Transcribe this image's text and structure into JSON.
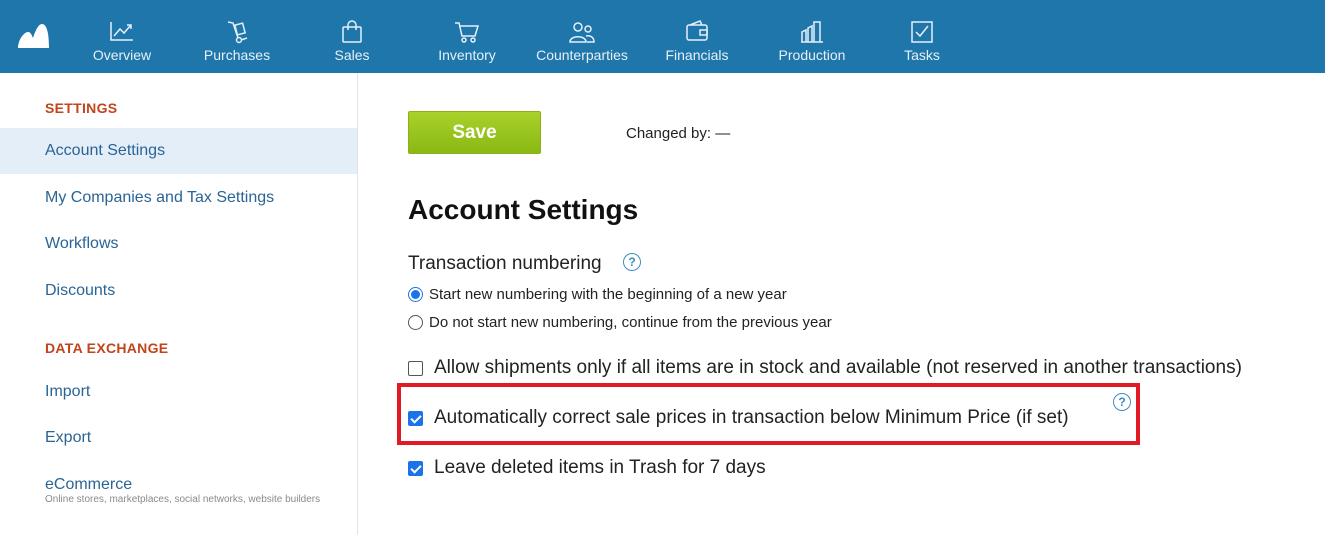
{
  "nav": {
    "items": [
      {
        "label": "Overview",
        "icon": "chart-line-icon"
      },
      {
        "label": "Purchases",
        "icon": "hand-truck-icon"
      },
      {
        "label": "Sales",
        "icon": "shopping-bag-icon"
      },
      {
        "label": "Inventory",
        "icon": "cart-icon"
      },
      {
        "label": "Counterparties",
        "icon": "people-icon"
      },
      {
        "label": "Financials",
        "icon": "wallet-icon"
      },
      {
        "label": "Production",
        "icon": "factory-icon"
      },
      {
        "label": "Tasks",
        "icon": "checkbox-icon"
      }
    ]
  },
  "sidebar": {
    "section_settings": "SETTINGS",
    "items": [
      {
        "label": "Account Settings"
      },
      {
        "label": "My Companies and Tax Settings"
      },
      {
        "label": "Workflows"
      },
      {
        "label": "Discounts"
      }
    ],
    "section_data_exchange": "DATA EXCHANGE",
    "exchange_items": [
      {
        "label": "Import"
      },
      {
        "label": "Export"
      },
      {
        "label": "eCommerce",
        "sub": "Online stores, marketplaces, social networks, website builders"
      }
    ]
  },
  "main": {
    "save_label": "Save",
    "changed_by": "Changed by: —",
    "title": "Account Settings",
    "numbering_label": "Transaction numbering",
    "help_glyph": "?",
    "radios": [
      {
        "label": "Start new numbering with the beginning of a new year",
        "checked": true
      },
      {
        "label": "Do not start new numbering, continue from the previous year",
        "checked": false
      }
    ],
    "checkboxes": [
      {
        "label": "Allow shipments only if all items are in stock and available (not reserved in another transactions)",
        "checked": false
      },
      {
        "label": "Automatically correct sale prices in transaction below Minimum Price (if set)",
        "checked": true
      },
      {
        "label": "Leave deleted items in Trash for 7 days",
        "checked": true
      }
    ]
  },
  "colors": {
    "topbar": "#1f76aa",
    "accent_section": "#c0451b",
    "link": "#2a6496",
    "save_green": "#8ab814",
    "highlight": "#e01b24"
  }
}
